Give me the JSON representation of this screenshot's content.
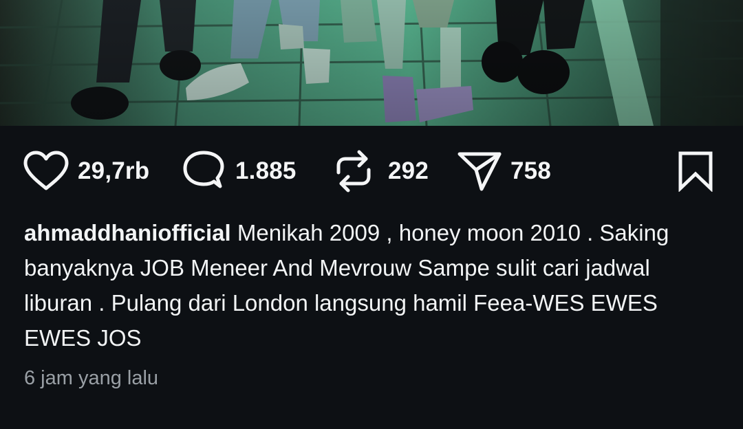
{
  "post": {
    "likes": "29,7rb",
    "comments": "1.885",
    "reposts": "292",
    "shares": "758",
    "username": "ahmaddhaniofficial",
    "caption": "Menikah 2009 , honey moon 2010 . Saking banyaknya JOB Meneer And Mevrouw Sampe sulit cari jadwal liburan . Pulang dari London langsung hamil Feea-WES EWES EWES JOS",
    "timestamp": "6 jam yang lalu"
  },
  "icons": {
    "like": "heart-outline-icon",
    "comment": "speech-bubble-icon",
    "repost": "repost-arrows-icon",
    "share": "paper-plane-icon",
    "save": "bookmark-outline-icon"
  },
  "colors": {
    "background": "#0d1014",
    "text": "#f2f4f5",
    "muted": "#9aa0a6",
    "photo_tint": "#5fd7a8"
  }
}
